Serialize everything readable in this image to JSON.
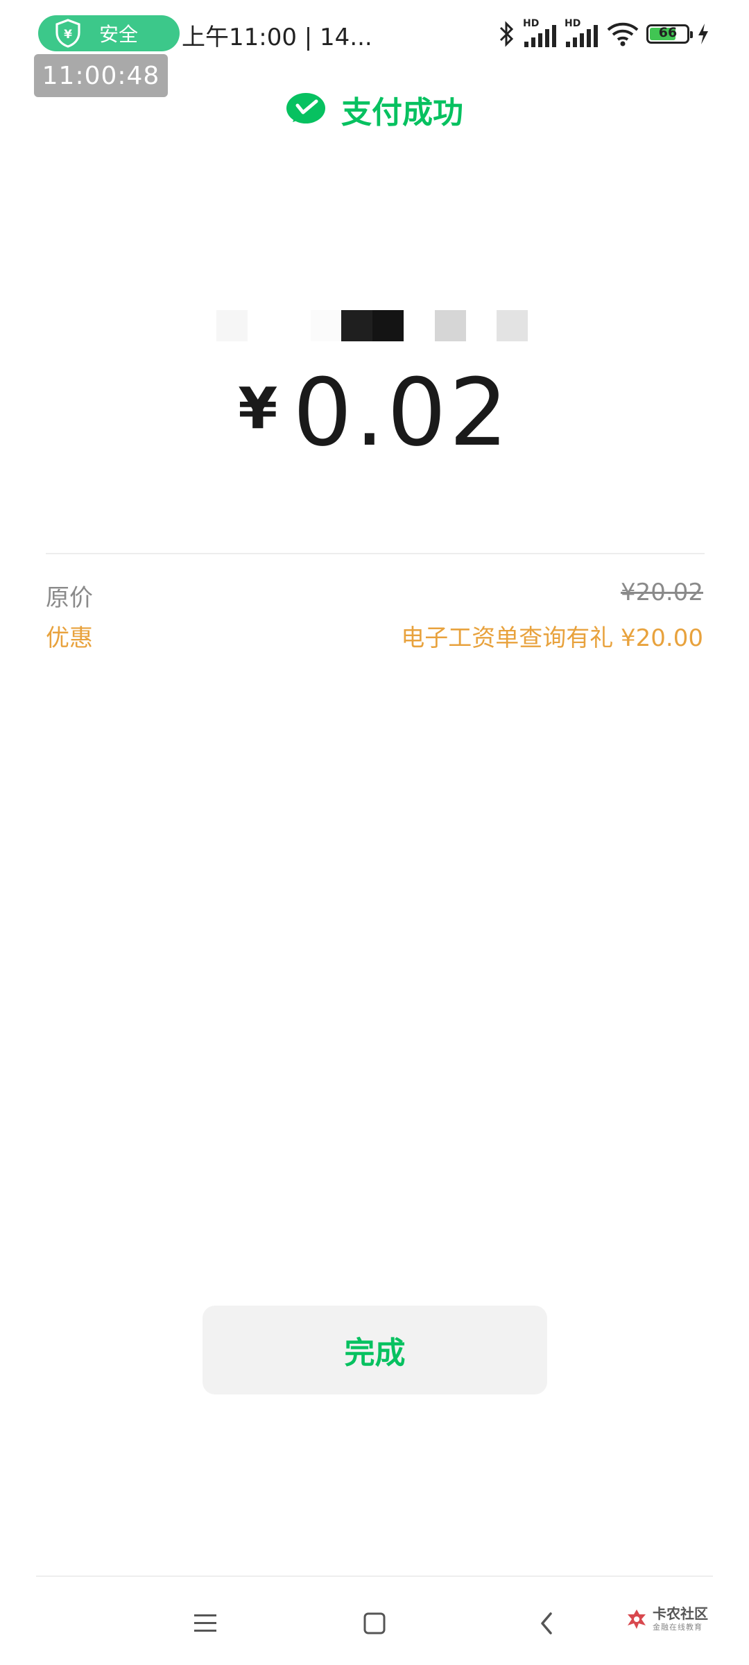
{
  "status_bar": {
    "security_label": "安全",
    "time_text": "上午11:00 | 14...",
    "clock_badge": "11:00:48",
    "battery_level": "66",
    "battery_fraction": 0.66,
    "network_labels": [
      "HD",
      "HD"
    ],
    "icons": [
      "shield-yen-icon",
      "bluetooth-icon",
      "signal-icon",
      "signal-icon",
      "wifi-icon",
      "battery-icon",
      "charging-icon"
    ]
  },
  "header": {
    "title": "支付成功",
    "logo_icon": "wechat-pay-icon"
  },
  "payment": {
    "currency": "¥",
    "amount": "0.02"
  },
  "details": {
    "original_price_label": "原价",
    "original_price_value": "¥20.02",
    "discount_label": "优惠",
    "discount_value": "电子工资单查询有礼 ¥20.00"
  },
  "actions": {
    "done_label": "完成"
  },
  "navigation": {
    "icons": [
      "menu-icon",
      "home-icon",
      "back-icon"
    ]
  },
  "watermark": {
    "main": "卡农社区",
    "sub": "金融在线教育"
  },
  "colors": {
    "brand_green": "#07c160",
    "safe_green": "#3cc88a",
    "discount_orange": "#e8a23d",
    "text_gray": "#8a8a8a",
    "button_bg": "#f2f2f2"
  }
}
